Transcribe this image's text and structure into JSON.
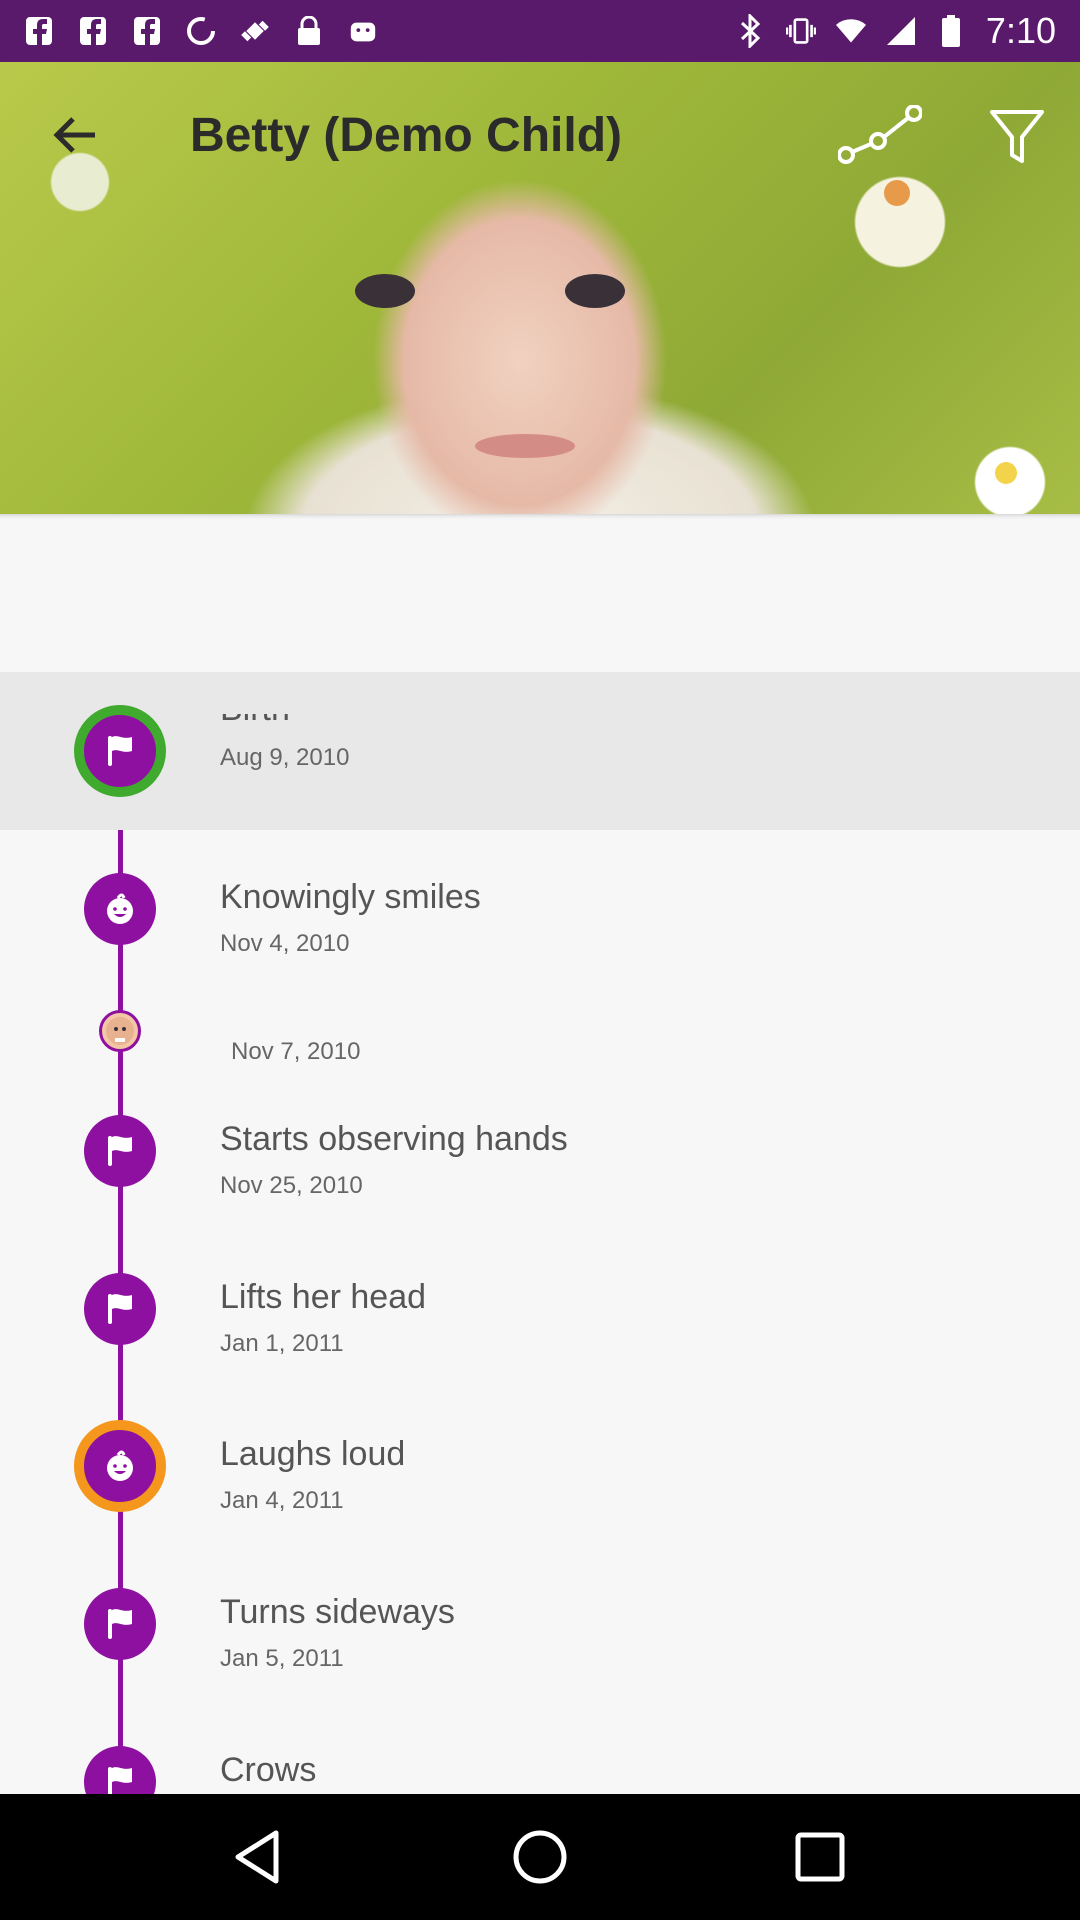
{
  "status_bar": {
    "time": "7:10",
    "left_icons": [
      "facebook-icon",
      "facebook-icon",
      "facebook-icon",
      "data-saver-icon",
      "fake-gps-icon",
      "lock-icon",
      "android-icon"
    ],
    "right_icons": [
      "bluetooth-icon",
      "vibrate-icon",
      "wifi-icon",
      "signal-icon",
      "battery-icon"
    ]
  },
  "toolbar": {
    "title": "Betty (Demo Child)",
    "back_icon": "arrow-back-icon",
    "chart_icon": "line-chart-icon",
    "filter_icon": "filter-icon"
  },
  "timeline": {
    "items": [
      {
        "title": "Birth",
        "date": "Aug 9, 2010",
        "icon": "flag-icon",
        "ring": "green",
        "highlighted": true
      },
      {
        "title": "Knowingly smiles",
        "date": "Nov 4, 2010",
        "icon": "baby-face-icon"
      },
      {
        "title": "",
        "date": "Nov 7, 2010",
        "icon": "photo-thumbnail"
      },
      {
        "title": "Starts observing hands",
        "date": "Nov 25, 2010",
        "icon": "flag-icon"
      },
      {
        "title": "Lifts her head",
        "date": "Jan 1, 2011",
        "icon": "flag-icon"
      },
      {
        "title": "Laughs loud",
        "date": "Jan 4, 2011",
        "icon": "baby-face-icon",
        "ring": "orange"
      },
      {
        "title": "Turns sideways",
        "date": "Jan 5, 2011",
        "icon": "flag-icon"
      },
      {
        "title": "Crows",
        "date": "",
        "icon": "flag-icon"
      }
    ]
  },
  "colors": {
    "status_bar": "#5a1a6b",
    "accent_purple": "#8e10a0",
    "ring_green": "#3faa2e",
    "ring_orange": "#f5961d",
    "highlight_row": "#e8e8e8",
    "nav_bar": "#000000"
  },
  "nav_bar": {
    "icons": [
      "back-triangle-icon",
      "home-circle-icon",
      "recents-square-icon"
    ]
  }
}
